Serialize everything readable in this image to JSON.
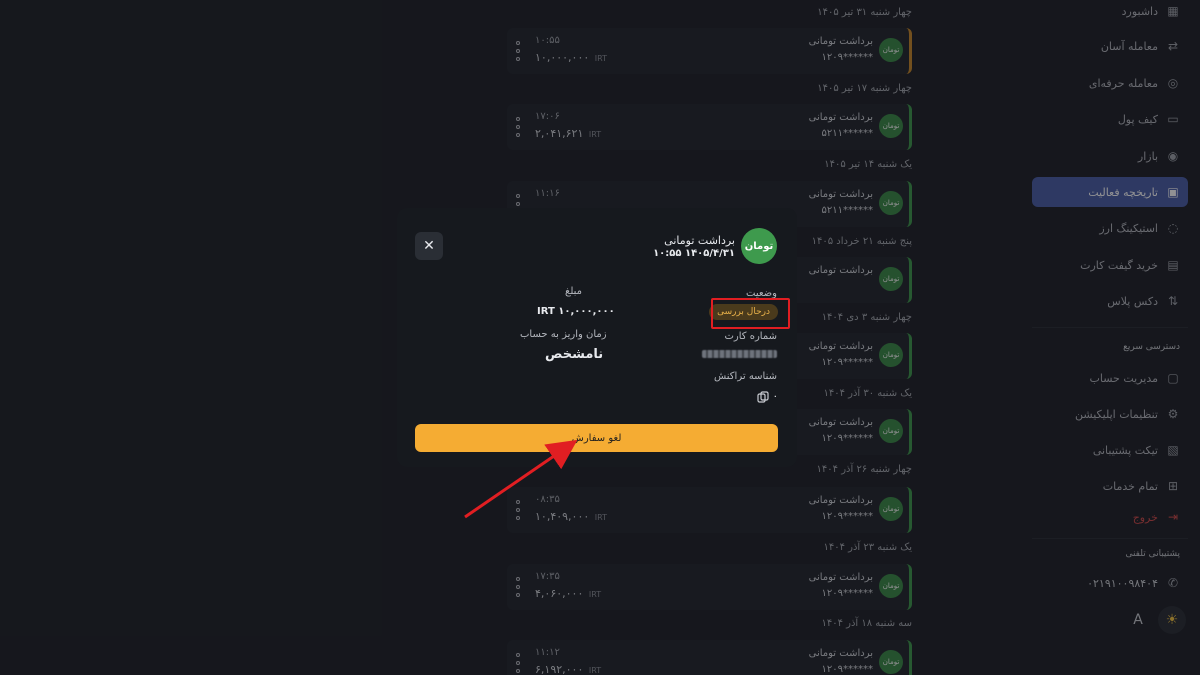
{
  "sidebar": {
    "items": [
      {
        "label": "داشبورد",
        "icon": "dashboard-icon"
      },
      {
        "label": "معامله آسان",
        "icon": "exchange-icon"
      },
      {
        "label": "معامله حرفه‌ای",
        "icon": "pro-trade-icon"
      },
      {
        "label": "کیف پول",
        "icon": "wallet-icon"
      },
      {
        "label": "بازار",
        "icon": "market-icon"
      },
      {
        "label": "تاریخچه فعالیت",
        "icon": "calendar-icon",
        "active": true
      },
      {
        "label": "استیکینگ ارز",
        "icon": "staking-icon"
      },
      {
        "label": "خرید گیفت کارت",
        "icon": "gift-icon"
      },
      {
        "label": "دکس پلاس",
        "icon": "dex-icon"
      }
    ],
    "quick_access_title": "دسترسی سریع",
    "quick_items": [
      {
        "label": "مدیریت حساب",
        "icon": "account-icon"
      },
      {
        "label": "تنظیمات اپلیکیشن",
        "icon": "settings-icon"
      },
      {
        "label": "تیکت پشتیبانی",
        "icon": "ticket-icon"
      },
      {
        "label": "تمام خدمات",
        "icon": "services-icon"
      }
    ],
    "exit_label": "خروج",
    "phone_support_title": "پشتیبانی تلفنی",
    "phone_number": "۰۲۱۹۱۰۰۹۸۴۰۴",
    "theme_font_btn": "A",
    "theme_sun_btn": "☀"
  },
  "activity": {
    "days": [
      {
        "label": "چهار شنبه ۳۱ تیر ۱۴۰۵",
        "txn": {
          "title": "برداشت  تومانی",
          "card": "******۱۲۰۹",
          "time": "۱۰:۵۵",
          "amount": "۱۰,۰۰۰,۰۰۰",
          "currency": "IRT",
          "pending": true
        }
      },
      {
        "label": "چهار شنبه ۱۷ تیر ۱۴۰۵",
        "txn": {
          "title": "برداشت  تومانی",
          "card": "******۵۲۱۱",
          "time": "۱۷:۰۶",
          "amount": "۲,۰۴۱,۶۲۱",
          "currency": "IRT"
        }
      },
      {
        "label": "یک شنبه ۱۴ تیر ۱۴۰۵",
        "txn": {
          "title": "برداشت  تومانی",
          "card": "******۵۲۱۱",
          "time": "۱۱:۱۶",
          "amount": "",
          "currency": ""
        }
      },
      {
        "label": "پنج شنبه ۲۱ خرداد ۱۴۰۵",
        "txn": {
          "title": "برداشت  تومانی",
          "card": "",
          "time": "",
          "amount": "",
          "currency": ""
        }
      },
      {
        "label": "چهار شنبه ۳ دی ۱۴۰۴",
        "txn": {
          "title": "برداشت  تومانی",
          "card": "******۱۲۰۹",
          "time": "",
          "amount": "",
          "currency": ""
        }
      },
      {
        "label": "یک شنبه ۳۰ آذر ۱۴۰۴",
        "txn": {
          "title": "برداشت  تومانی",
          "card": "******۱۲۰۹",
          "time": "",
          "amount": "",
          "currency": ""
        }
      },
      {
        "label": "چهار شنبه ۲۶ آذر ۱۴۰۴",
        "txn": {
          "title": "برداشت  تومانی",
          "card": "******۱۲۰۹",
          "time": "۰۸:۳۵",
          "amount": "۱۰,۴۰۹,۰۰۰",
          "currency": "IRT"
        }
      },
      {
        "label": "یک شنبه ۲۳ آذر ۱۴۰۴",
        "txn": {
          "title": "برداشت  تومانی",
          "card": "******۱۲۰۹",
          "time": "۱۷:۳۵",
          "amount": "۴,۰۶۰,۰۰۰",
          "currency": "IRT"
        }
      },
      {
        "label": "سه شنبه ۱۸ آذر ۱۴۰۴",
        "txn": {
          "title": "برداشت  تومانی",
          "card": "******۱۲۰۹",
          "time": "۱۱:۱۲",
          "amount": "۶,۱۹۲,۰۰۰",
          "currency": "IRT"
        }
      }
    ],
    "avatar_label": "تومان"
  },
  "modal": {
    "avatar_label": "تومان",
    "title": "برداشت  تومانی",
    "datetime": "۱۴۰۵/۴/۳۱ ۱۰:۵۵",
    "close_symbol": "✕",
    "status_label": "وضعیت",
    "status_value": "درحال بررسی",
    "amount_label": "مبلغ",
    "amount_value": "IRT ۱۰,۰۰۰,۰۰۰",
    "deposit_time_label": "زمان واریز به حساب",
    "deposit_time_value": "نامشخص",
    "card_label": "شماره کارت",
    "tracking_label": "شناسه تراکنش",
    "tracking_value": "۰",
    "cancel_label": "لغو سفارش"
  },
  "colors": {
    "accent": "#4b5fa8",
    "success": "#3e9a4d",
    "warning": "#f5ac33",
    "danger": "#e11e22"
  }
}
